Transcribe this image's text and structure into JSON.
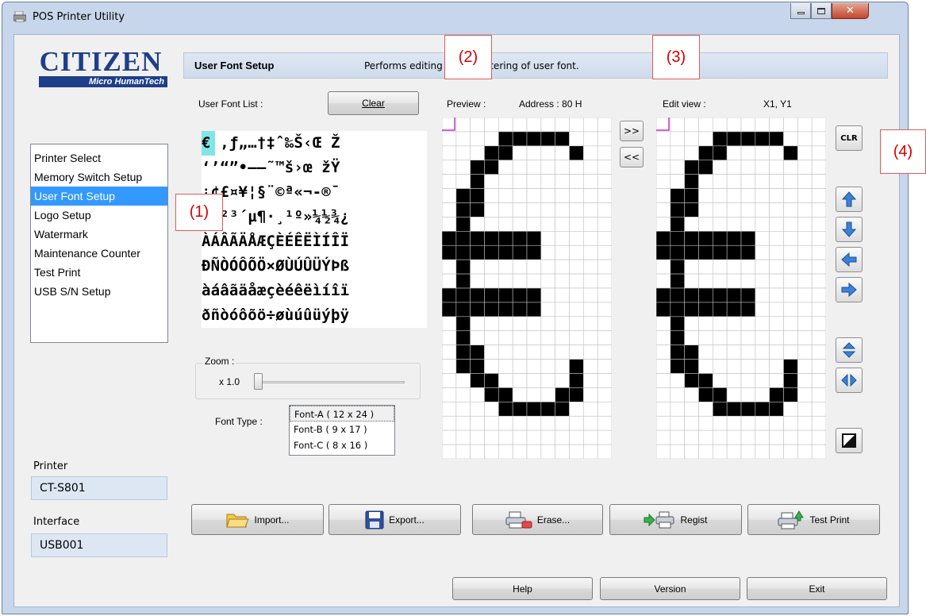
{
  "window": {
    "title": "POS Printer Utility",
    "controls": [
      "minimize",
      "maximize",
      "close"
    ]
  },
  "logo": {
    "brand": "CITIZEN",
    "tagline": "Micro HumanTech"
  },
  "banner": {
    "title": "User Font Setup",
    "description": "Performs editing and registering of user font."
  },
  "sidebar": {
    "items": [
      {
        "label": "Printer Select",
        "selected": false
      },
      {
        "label": "Memory Switch Setup",
        "selected": false
      },
      {
        "label": "User Font Setup",
        "selected": true
      },
      {
        "label": "Logo Setup",
        "selected": false
      },
      {
        "label": "Watermark",
        "selected": false
      },
      {
        "label": "Maintenance Counter",
        "selected": false
      },
      {
        "label": "Test Print",
        "selected": false
      },
      {
        "label": "USB S/N Setup",
        "selected": false
      }
    ],
    "printer_label": "Printer",
    "printer_value": "CT-S801",
    "interface_label": "Interface",
    "interface_value": "USB001"
  },
  "font_list": {
    "label": "User Font List :",
    "clear_button": "Clear",
    "rows": [
      "€ ‚ƒ„…†‡ˆ‰Š‹Œ Ž ",
      " ‘’“”•–—˜™š›œ žŸ",
      " ¡¢£¤¥¦§¨©ª«¬-®¯",
      "°±²³´µ¶·¸¹º»¼½¾¿",
      "ÀÁÂÃÄÅÆÇÈÉÊËÌÍÎÏ",
      "ÐÑÒÓÔÕÖ×ØÙÚÛÜÝÞß",
      "àáâãäåæçèéêëìíîï",
      "ðñòóôõö÷øùúûüýþÿ"
    ],
    "zoom_label": "Zoom :",
    "zoom_value": "x 1.0",
    "zoom_level": 0,
    "font_type_label": "Font Type :",
    "font_types": [
      "Font-A ( 12 x 24 )",
      "Font-B ( 9 x 17 )",
      "Font-C ( 8 x 16 )"
    ],
    "selected_font_type": 0
  },
  "preview": {
    "label": "Preview :",
    "address": "Address :  80 H",
    "columns": 12,
    "rows": 24,
    "bitmap": [
      "000000000000",
      "000011111000",
      "000110000100",
      "001100000000",
      "001000000000",
      "011000000000",
      "011000000000",
      "010000000000",
      "111111100000",
      "111111100000",
      "010000000000",
      "010000000000",
      "111111100000",
      "111111100000",
      "010000000000",
      "010000000000",
      "011000000000",
      "011000000100",
      "001100000100",
      "000110001100",
      "000011111000",
      "000000000000",
      "000000000000",
      "000000000000"
    ]
  },
  "transfer": {
    "copy_right": ">>",
    "copy_left": "<<"
  },
  "edit_view": {
    "label": "Edit view :",
    "position": "X1, Y1"
  },
  "tools": {
    "clear": "CLR"
  },
  "actions": [
    {
      "label": "Import...",
      "icon": "folder-icon"
    },
    {
      "label": "Export...",
      "icon": "floppy-disk-icon"
    },
    {
      "label": "Erase...",
      "icon": "printer-erase-icon"
    },
    {
      "label": "Regist",
      "icon": "printer-register-icon"
    },
    {
      "label": "Test Print",
      "icon": "printer-test-icon"
    }
  ],
  "footer": {
    "help": "Help",
    "version": "Version",
    "exit": "Exit"
  },
  "callouts": [
    "(1)",
    "(2)",
    "(3)",
    "(4)"
  ]
}
